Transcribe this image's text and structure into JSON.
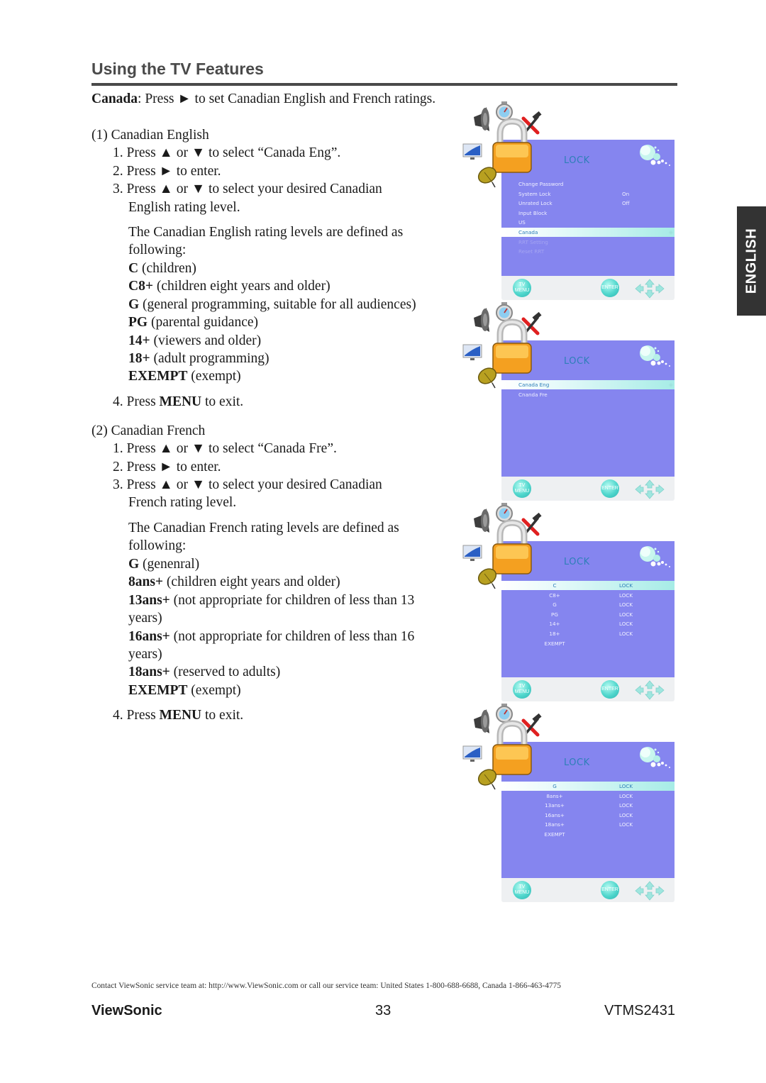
{
  "header": {
    "title": "Using the TV Features"
  },
  "language_tab": "ENGLISH",
  "intro": {
    "bold": "Canada",
    "rest": ": Press ► to set Canadian English and French ratings."
  },
  "canadian_english": {
    "heading": "(1) Canadian English",
    "steps": [
      "1. Press ▲ or ▼ to select “Canada Eng”.",
      "2. Press ► to enter.",
      "3. Press ▲ or ▼ to select your desired Canadian",
      "English rating level."
    ],
    "definition_intro": [
      "The Canadian English rating levels are defined as",
      "following:"
    ],
    "ratings": [
      {
        "code": "C",
        "desc": " (children)"
      },
      {
        "code": "C8+",
        "desc": " (children eight years and older)"
      },
      {
        "code": "G",
        "desc": " (general programming, suitable for all audiences)"
      },
      {
        "code": "PG",
        "desc": " (parental guidance)"
      },
      {
        "code": "14+",
        "desc": " (viewers and older)"
      },
      {
        "code": "18+",
        "desc": " (adult programming)"
      },
      {
        "code": "EXEMPT",
        "desc": " (exempt)"
      }
    ],
    "exit": {
      "pre": "4. Press ",
      "bold": "MENU",
      "post": " to exit."
    }
  },
  "canadian_french": {
    "heading": "(2) Canadian French",
    "steps": [
      "1. Press ▲ or ▼ to select “Canada Fre”.",
      "2. Press ► to enter.",
      "3. Press ▲ or ▼ to select your desired Canadian",
      "French rating level."
    ],
    "definition_intro": [
      "The Canadian French rating levels are defined as",
      "following:"
    ],
    "ratings": [
      {
        "code": "G",
        "desc": " (genenral)"
      },
      {
        "code": "8ans+",
        "desc": " (children eight years and older)"
      },
      {
        "code": "13ans+",
        "desc": " (not appropriate for children of less than 13"
      },
      {
        "code": "",
        "desc": "years)"
      },
      {
        "code": "16ans+",
        "desc": " (not appropriate for children of less than 16"
      },
      {
        "code": "",
        "desc": "years)"
      },
      {
        "code": "18ans+",
        "desc": " (reserved to adults)"
      },
      {
        "code": "EXEMPT",
        "desc": " (exempt)"
      }
    ],
    "exit": {
      "pre": "4. Press ",
      "bold": "MENU",
      "post": " to exit."
    }
  },
  "osd_screens": [
    {
      "title": "LOCK",
      "layout": "list",
      "rows": [
        {
          "label": "Change Password",
          "value": "",
          "state": "normal"
        },
        {
          "label": "System Lock",
          "value": "On",
          "state": "normal"
        },
        {
          "label": "Unrated Lock",
          "value": "Off",
          "state": "normal"
        },
        {
          "label": "Input Block",
          "value": "",
          "state": "normal"
        },
        {
          "label": "US",
          "value": "",
          "state": "normal"
        },
        {
          "label": "Canada",
          "value": "",
          "state": "selected"
        },
        {
          "label": "RRT Setting",
          "value": "",
          "state": "disabled"
        },
        {
          "label": "Reset RRT",
          "value": "",
          "state": "disabled"
        }
      ]
    },
    {
      "title": "LOCK",
      "layout": "list",
      "rows": [
        {
          "label": "Canada Eng",
          "value": "",
          "state": "selected"
        },
        {
          "label": "Cnanda Fre",
          "value": "",
          "state": "normal"
        }
      ]
    },
    {
      "title": "LOCK",
      "layout": "center",
      "rows": [
        {
          "label": "C",
          "value": "LOCK",
          "state": "selected"
        },
        {
          "label": "C8+",
          "value": "LOCK",
          "state": "normal"
        },
        {
          "label": "G",
          "value": "LOCK",
          "state": "normal"
        },
        {
          "label": "PG",
          "value": "LOCK",
          "state": "normal"
        },
        {
          "label": "14+",
          "value": "LOCK",
          "state": "normal"
        },
        {
          "label": "18+",
          "value": "LOCK",
          "state": "normal"
        },
        {
          "label": "EXEMPT",
          "value": "",
          "state": "normal"
        }
      ]
    },
    {
      "title": "LOCK",
      "layout": "center",
      "rows": [
        {
          "label": "G",
          "value": "LOCK",
          "state": "selected"
        },
        {
          "label": "8ans+",
          "value": "LOCK",
          "state": "normal"
        },
        {
          "label": "13ans+",
          "value": "LOCK",
          "state": "normal"
        },
        {
          "label": "16ans+",
          "value": "LOCK",
          "state": "normal"
        },
        {
          "label": "18ans+",
          "value": "LOCK",
          "state": "normal"
        },
        {
          "label": "EXEMPT",
          "value": "",
          "state": "normal"
        }
      ]
    }
  ],
  "osd_footer": {
    "menu_button": "TV MENU",
    "enter_button": "ENTER"
  },
  "osd_icons": [
    "speaker-icon",
    "stopwatch-icon",
    "tools-icon",
    "monitor-icon",
    "padlock-icon",
    "satellite-dish-icon"
  ],
  "colors": {
    "osd_body": "#8585ef",
    "osd_title": "#2e7fb8",
    "selected_highlight": "#a6ece6",
    "heading": "#4a4a4a",
    "language_tab": "#333333"
  },
  "footer": {
    "contact": "Contact ViewSonic service team at: http://www.ViewSonic.com or call our service team: United States 1-800-688-6688, Canada 1-866-463-4775",
    "brand": "ViewSonic",
    "page_number": "33",
    "model": "VTMS2431"
  }
}
